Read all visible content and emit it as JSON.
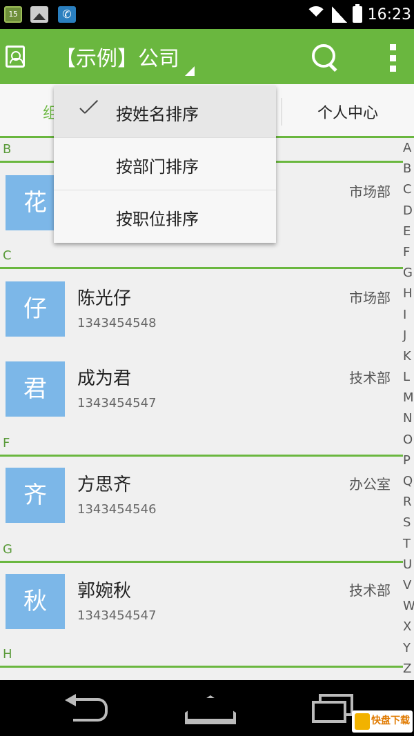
{
  "status_bar": {
    "notif_badge": "15",
    "time": "16:23"
  },
  "app_bar": {
    "title": "【示例】公司"
  },
  "tabs": {
    "left_partial": "组",
    "right": "个人中心"
  },
  "sort_menu": {
    "items": [
      {
        "label": "按姓名排序",
        "checked": true
      },
      {
        "label": "按部门排序",
        "checked": false
      },
      {
        "label": "按职位排序",
        "checked": false
      }
    ]
  },
  "contacts": {
    "sections": [
      {
        "letter": "B",
        "rows": [
          {
            "avatar": "花",
            "name": "",
            "phone": "",
            "dept": "市场部"
          }
        ]
      },
      {
        "letter": "C",
        "rows": [
          {
            "avatar": "仔",
            "name": "陈光仔",
            "phone": "1343454548",
            "dept": "市场部"
          },
          {
            "avatar": "君",
            "name": "成为君",
            "phone": "1343454547",
            "dept": "技术部"
          }
        ]
      },
      {
        "letter": "F",
        "rows": [
          {
            "avatar": "齐",
            "name": "方思齐",
            "phone": "1343454546",
            "dept": "办公室"
          }
        ]
      },
      {
        "letter": "G",
        "rows": [
          {
            "avatar": "秋",
            "name": "郭婉秋",
            "phone": "1343454547",
            "dept": "技术部"
          }
        ]
      },
      {
        "letter": "H",
        "rows": []
      }
    ]
  },
  "alphabet": [
    "A",
    "B",
    "C",
    "D",
    "E",
    "F",
    "G",
    "H",
    "I",
    "J",
    "K",
    "L",
    "M",
    "N",
    "O",
    "P",
    "Q",
    "R",
    "S",
    "T",
    "U",
    "V",
    "W",
    "X",
    "Y",
    "Z"
  ],
  "watermark": {
    "text": "快盘下载"
  },
  "colors": {
    "accent": "#6ab73f",
    "avatar": "#7cb7e8"
  }
}
